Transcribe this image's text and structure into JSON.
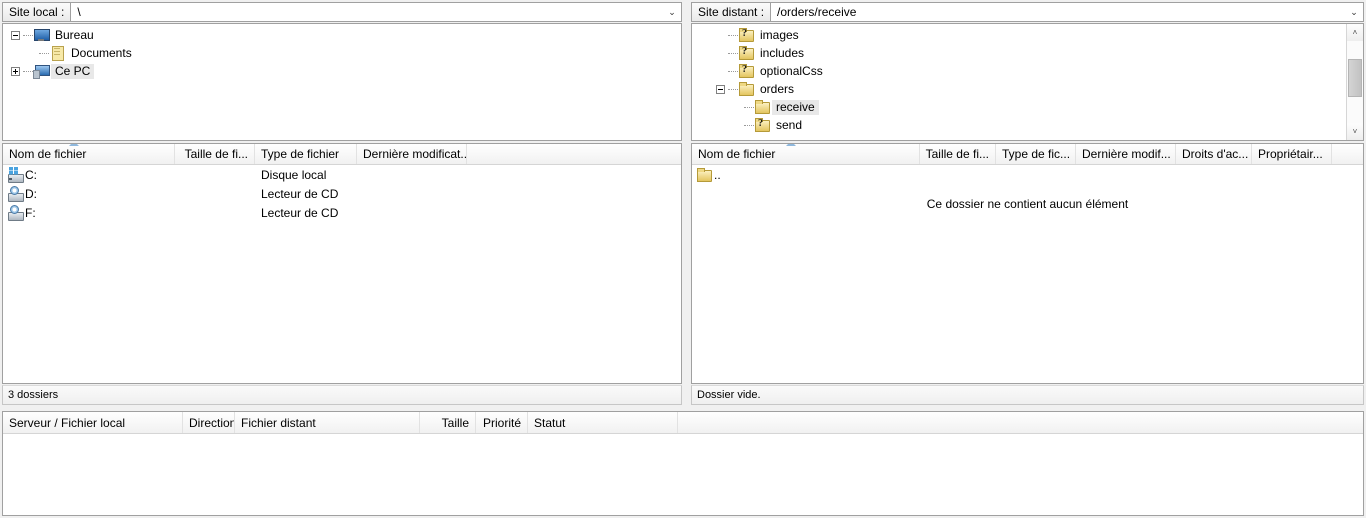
{
  "local_pane": {
    "site_label": "Site local :",
    "site_path": "\\",
    "tree": [
      {
        "label": "Bureau",
        "icon": "desktop-icon",
        "depth": 0,
        "expander": "minus",
        "selected": false
      },
      {
        "label": "Documents",
        "icon": "documents-icon",
        "depth": 1,
        "expander": "none",
        "selected": false
      },
      {
        "label": "Ce PC",
        "icon": "computer-icon",
        "depth": 0,
        "expander": "plus",
        "selected": true
      }
    ],
    "columns": [
      "Nom de fichier",
      "Taille de fi...",
      "Type de fichier",
      "Dernière modificat..."
    ],
    "rows": [
      {
        "name": "C:",
        "icon": "hard-drive-icon",
        "size": "",
        "type": "Disque local",
        "modified": ""
      },
      {
        "name": "D:",
        "icon": "cd-drive-icon",
        "size": "",
        "type": "Lecteur de CD",
        "modified": ""
      },
      {
        "name": "F:",
        "icon": "cd-drive-icon",
        "size": "",
        "type": "Lecteur de CD",
        "modified": ""
      }
    ],
    "status": "3 dossiers"
  },
  "remote_pane": {
    "site_label": "Site distant :",
    "site_path": "/orders/receive",
    "tree": [
      {
        "label": "images",
        "icon": "folder-unknown-icon",
        "depth": 1,
        "expander": "none",
        "selected": false
      },
      {
        "label": "includes",
        "icon": "folder-unknown-icon",
        "depth": 1,
        "expander": "none",
        "selected": false
      },
      {
        "label": "optionalCss",
        "icon": "folder-unknown-icon",
        "depth": 1,
        "expander": "none",
        "selected": false
      },
      {
        "label": "orders",
        "icon": "folder-icon",
        "depth": 1,
        "expander": "minus",
        "selected": false
      },
      {
        "label": "receive",
        "icon": "folder-icon",
        "depth": 2,
        "expander": "none",
        "selected": true
      },
      {
        "label": "send",
        "icon": "folder-unknown-icon",
        "depth": 2,
        "expander": "none",
        "selected": false
      }
    ],
    "columns": [
      "Nom de fichier",
      "Taille de fi...",
      "Type de fic...",
      "Dernière modif...",
      "Droits d'ac...",
      "Propriétair..."
    ],
    "rows": [
      {
        "name": "..",
        "icon": "folder-icon",
        "size": "",
        "type": "",
        "modified": "",
        "permissions": "",
        "owner": ""
      }
    ],
    "empty_message": "Ce dossier ne contient aucun élément",
    "status": "Dossier vide.",
    "scrollbar": {
      "up_arrow": "˄",
      "down_arrow": "˅"
    }
  },
  "queue": {
    "columns": [
      "Serveur / Fichier local",
      "Direction",
      "Fichier distant",
      "Taille",
      "Priorité",
      "Statut"
    ],
    "rows": []
  },
  "icons": {
    "combo_arrow": "⌄",
    "folder_unknown_mark": "?"
  }
}
